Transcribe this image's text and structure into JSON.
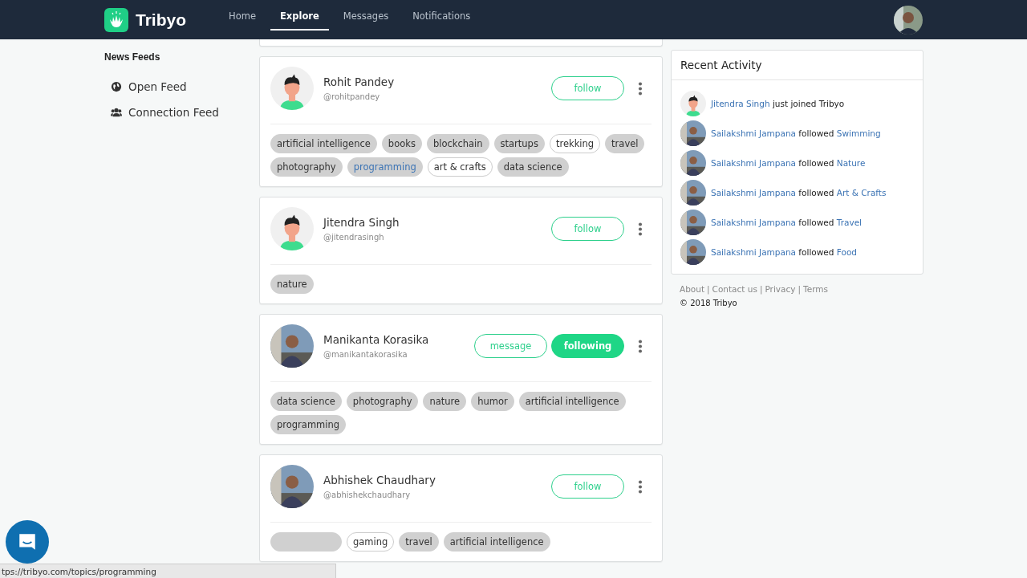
{
  "navbar": {
    "brand": "Tribyo",
    "links": [
      {
        "label": "Home",
        "selected": false
      },
      {
        "label": "Explore",
        "selected": true
      },
      {
        "label": "Messages",
        "selected": false
      },
      {
        "label": "Notifications",
        "selected": false
      }
    ]
  },
  "sidebar": {
    "heading": "News Feeds",
    "items": [
      {
        "label": "Open Feed",
        "kind": "globe"
      },
      {
        "label": "Connection Feed",
        "kind": "users"
      }
    ]
  },
  "cards": [
    {
      "name": "Rohit Pandey",
      "handle": "@rohitpandey",
      "has_photo": false,
      "buttons": [
        {
          "label": "follow",
          "kind": "outline"
        }
      ],
      "tags": [
        {
          "label": "artificial intelligence",
          "followed": true,
          "hovered": false
        },
        {
          "label": "books",
          "followed": true,
          "hovered": false
        },
        {
          "label": "blockchain",
          "followed": true,
          "hovered": false
        },
        {
          "label": "startups",
          "followed": true,
          "hovered": false
        },
        {
          "label": "trekking",
          "followed": false,
          "hovered": false
        },
        {
          "label": "travel",
          "followed": true,
          "hovered": false
        },
        {
          "label": "photography",
          "followed": true,
          "hovered": false
        },
        {
          "label": "programming",
          "followed": true,
          "hovered": true
        },
        {
          "label": "art & crafts",
          "followed": false,
          "hovered": false
        },
        {
          "label": "data science",
          "followed": true,
          "hovered": false
        }
      ]
    },
    {
      "name": "Jitendra Singh",
      "handle": "@jitendrasingh",
      "has_photo": false,
      "buttons": [
        {
          "label": "follow",
          "kind": "outline"
        }
      ],
      "tags": [
        {
          "label": "nature",
          "followed": true,
          "hovered": false
        }
      ]
    },
    {
      "name": "Manikanta Korasika",
      "handle": "@manikantakorasika",
      "has_photo": true,
      "buttons": [
        {
          "label": "message",
          "kind": "outline"
        },
        {
          "label": "following",
          "kind": "solid"
        }
      ],
      "tags": [
        {
          "label": "data science",
          "followed": true,
          "hovered": false
        },
        {
          "label": "photography",
          "followed": true,
          "hovered": false
        },
        {
          "label": "nature",
          "followed": true,
          "hovered": false
        },
        {
          "label": "humor",
          "followed": true,
          "hovered": false
        },
        {
          "label": "artificial intelligence",
          "followed": true,
          "hovered": false
        },
        {
          "label": "programming",
          "followed": true,
          "hovered": false
        }
      ]
    },
    {
      "name": "Abhishek Chaudhary",
      "handle": "@abhishekchaudhary",
      "has_photo": true,
      "buttons": [
        {
          "label": "follow",
          "kind": "outline"
        }
      ],
      "tags": [
        {
          "followed": true,
          "hovered": false
        },
        {
          "label": "gaming",
          "followed": false,
          "hovered": false
        },
        {
          "label": "travel",
          "followed": true,
          "hovered": false
        },
        {
          "label": "artificial intelligence",
          "followed": true,
          "hovered": false
        }
      ]
    }
  ],
  "recent_activity": {
    "title": "Recent Activity",
    "items": [
      {
        "has_photo": false,
        "actor": "Jitendra Singh",
        "action": "just joined Tribyo"
      },
      {
        "has_photo": true,
        "actor": "Sailakshmi Jampana",
        "action": "followed",
        "target": "Swimming"
      },
      {
        "has_photo": true,
        "actor": "Sailakshmi Jampana",
        "action": "followed",
        "target": "Nature"
      },
      {
        "has_photo": true,
        "actor": "Sailakshmi Jampana",
        "action": "followed",
        "target": "Art & Crafts"
      },
      {
        "has_photo": true,
        "actor": "Sailakshmi Jampana",
        "action": "followed",
        "target": "Travel"
      },
      {
        "has_photo": true,
        "actor": "Sailakshmi Jampana",
        "action": "followed",
        "target": "Food"
      }
    ]
  },
  "footer": {
    "links": [
      "About",
      "Contact us",
      "Privacy",
      "Terms"
    ],
    "separator": "|",
    "copyright": "© 2018 Tribyo"
  },
  "status_bar": {
    "url": "tps://tribyo.com/topics/programming"
  }
}
